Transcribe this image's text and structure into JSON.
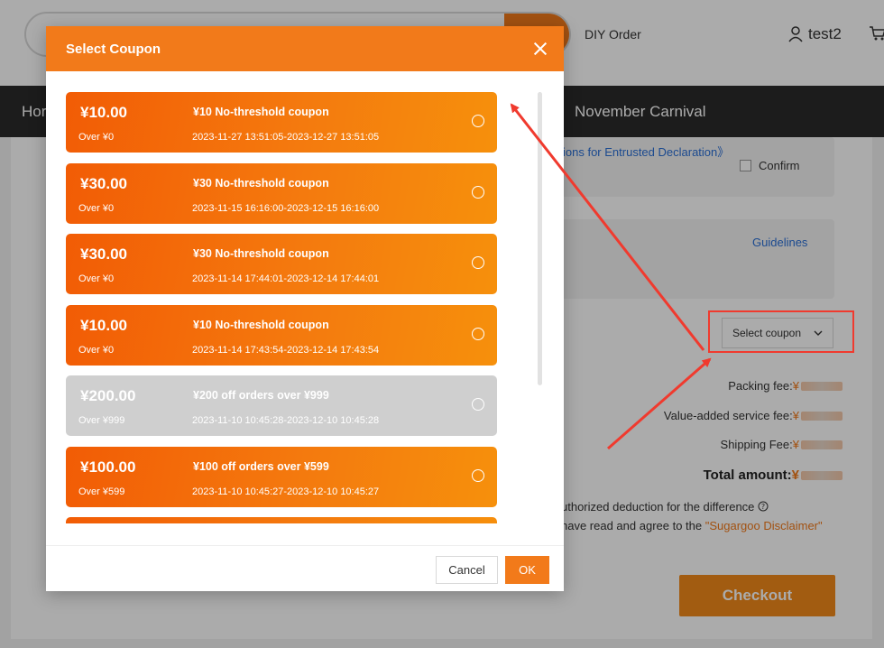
{
  "header": {
    "diy_order": "DIY Order",
    "username": "test2"
  },
  "nav": {
    "items": [
      "Hor",
      "November Carnival"
    ]
  },
  "background": {
    "declaration_link": "ions for Entrusted Declaration》",
    "confirm_label": "Confirm",
    "guidelines_link": "Guidelines",
    "select_coupon": "Select coupon",
    "packing_fee_label": "Packing fee:",
    "value_added_label": "Value-added service fee:",
    "shipping_fee_label": "Shipping Fee:",
    "total_amount_label": "Total amount:",
    "currency": "¥",
    "deduction_text": "uthorized deduction for the difference",
    "agree_text": "have read and agree to the ",
    "disclaimer": "\"Sugargoo Disclaimer\"",
    "checkout": "Checkout"
  },
  "modal": {
    "title": "Select Coupon",
    "cancel": "Cancel",
    "ok": "OK",
    "coupons": [
      {
        "amount": "¥10.00",
        "threshold": "Over ¥0",
        "title": "¥10 No-threshold coupon",
        "validity": "2023-11-27 13:51:05-2023-12-27 13:51:05",
        "disabled": false
      },
      {
        "amount": "¥30.00",
        "threshold": "Over ¥0",
        "title": "¥30 No-threshold coupon",
        "validity": "2023-11-15 16:16:00-2023-12-15 16:16:00",
        "disabled": false
      },
      {
        "amount": "¥30.00",
        "threshold": "Over ¥0",
        "title": "¥30 No-threshold coupon",
        "validity": "2023-11-14 17:44:01-2023-12-14 17:44:01",
        "disabled": false
      },
      {
        "amount": "¥10.00",
        "threshold": "Over ¥0",
        "title": "¥10 No-threshold coupon",
        "validity": "2023-11-14 17:43:54-2023-12-14 17:43:54",
        "disabled": false
      },
      {
        "amount": "¥200.00",
        "threshold": "Over ¥999",
        "title": "¥200 off orders over ¥999",
        "validity": "2023-11-10 10:45:28-2023-12-10 10:45:28",
        "disabled": true
      },
      {
        "amount": "¥100.00",
        "threshold": "Over ¥599",
        "title": "¥100 off orders over ¥599",
        "validity": "2023-11-10 10:45:27-2023-12-10 10:45:27",
        "disabled": false
      },
      {
        "amount": "",
        "threshold": "",
        "title": "",
        "validity": "",
        "disabled": false
      }
    ]
  },
  "colors": {
    "accent": "#f27a1a",
    "annotation": "#f03a2e",
    "disabled_coupon": "#cfcfcf"
  }
}
